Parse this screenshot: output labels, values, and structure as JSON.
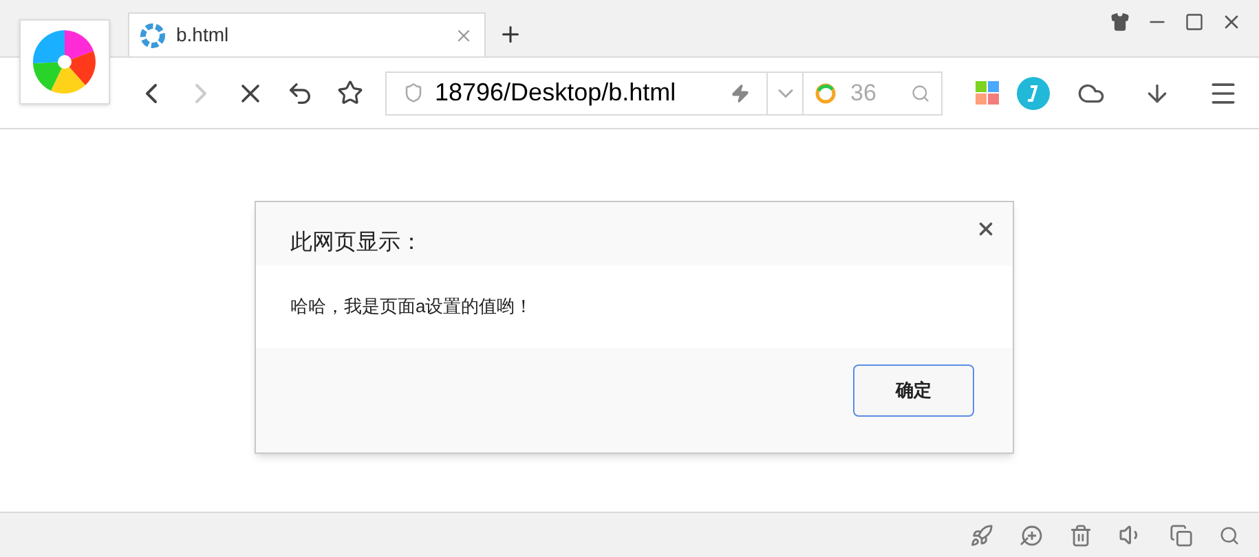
{
  "tabs": [
    {
      "title": "b.html",
      "selected": true
    }
  ],
  "address_bar": {
    "value": "18796/Desktop/b.html"
  },
  "search_box": {
    "badge": "36"
  },
  "dialog": {
    "title": "此网页显示：",
    "message": "哈哈，我是页面a设置的值哟！",
    "buttons": [
      "确定"
    ]
  }
}
